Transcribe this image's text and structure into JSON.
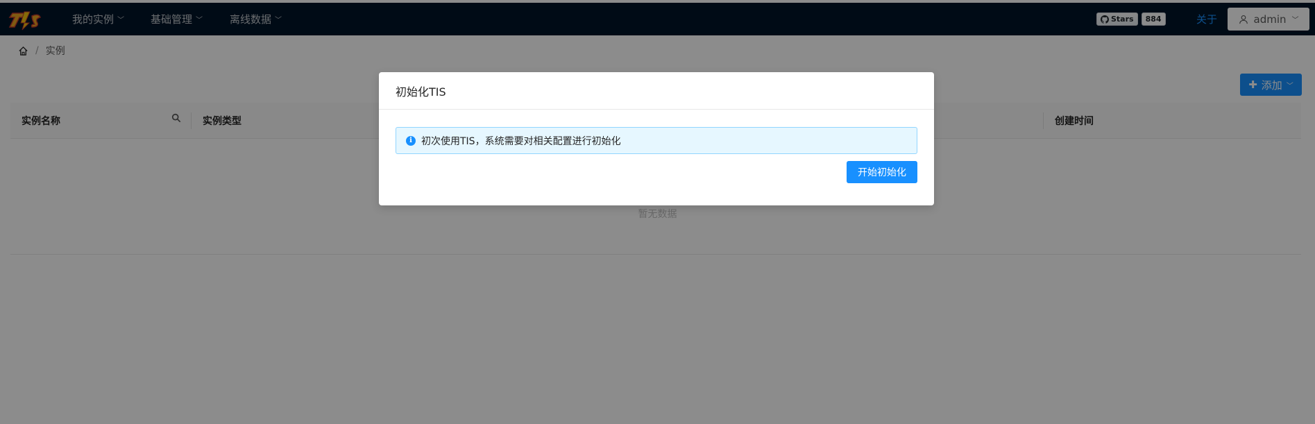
{
  "header": {
    "nav": [
      {
        "label": "我的实例"
      },
      {
        "label": "基础管理"
      },
      {
        "label": "离线数据"
      }
    ],
    "github": {
      "label": "Stars",
      "count": "884"
    },
    "about_label": "关于",
    "user_label": "admin"
  },
  "breadcrumb": {
    "current": "实例",
    "separator": "/"
  },
  "toolbar": {
    "add_label": "添加"
  },
  "table": {
    "columns": [
      "实例名称",
      "实例类型",
      "创建时间"
    ],
    "empty_text": "暂无数据"
  },
  "modal": {
    "title": "初始化TIS",
    "alert_text": "初次使用TIS，系统需要对相关配置进行初始化",
    "start_label": "开始初始化"
  },
  "colors": {
    "header_bg": "#001529",
    "primary": "#1890ff",
    "alert_bg": "#e6f7ff"
  }
}
